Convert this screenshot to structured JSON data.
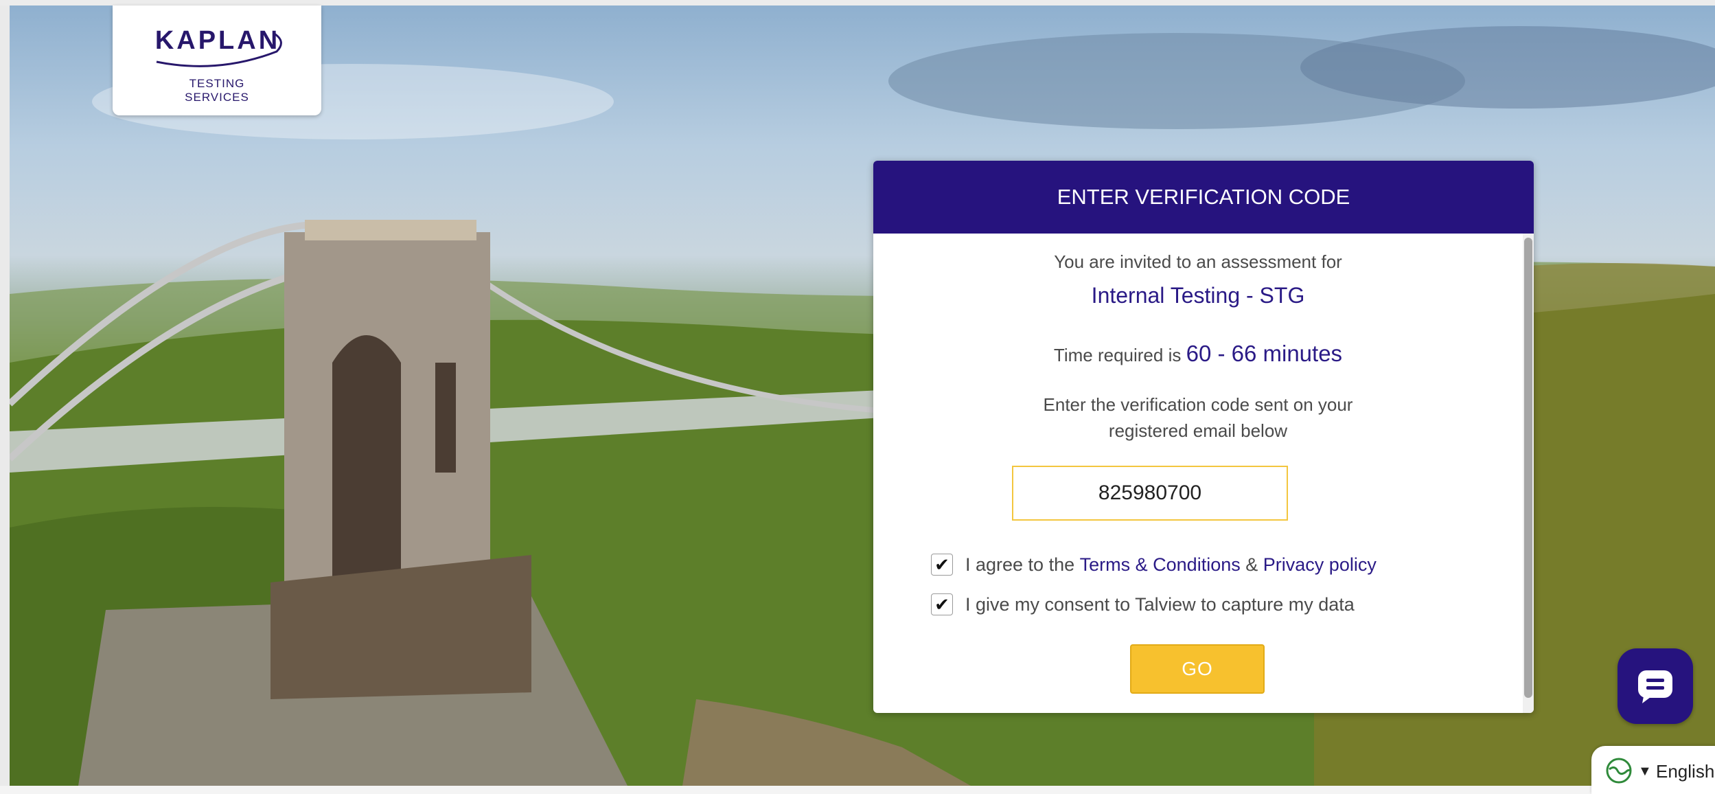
{
  "logo": {
    "brand": "KAPLAN",
    "sub1": "TESTING",
    "sub2": "SERVICES"
  },
  "card": {
    "title": "ENTER VERIFICATION CODE",
    "invited_text": "You are invited to an assessment for",
    "assessment_name": "Internal Testing - STG",
    "time_prefix": "Time required is",
    "time_value": "60 - 66 minutes",
    "instruction_line1": "Enter the verification code sent on your",
    "instruction_line2": "registered email below",
    "code_value": "825980700",
    "checkbox1": {
      "checked": true,
      "prefix": "I agree to the",
      "terms_link": "Terms & Conditions",
      "ampersand": "&",
      "privacy_link": "Privacy policy"
    },
    "checkbox2": {
      "checked": true,
      "label": "I give my consent to Talview to capture my data"
    },
    "go_label": "GO"
  },
  "chat": {
    "icon": "chat-bubble-icon"
  },
  "language": {
    "icon": "globe-icon",
    "label": "English"
  },
  "colors": {
    "header_bg": "#26137e",
    "accent_text": "#2a1a86",
    "go_button": "#f7c12e",
    "code_border": "#f3c63f"
  }
}
